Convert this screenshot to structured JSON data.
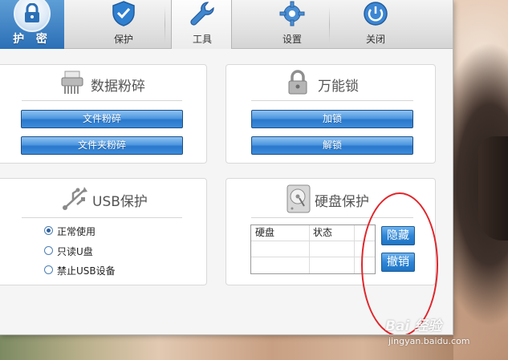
{
  "toolbar": {
    "logo_text": "护 密",
    "tabs": [
      {
        "label": "保护",
        "icon": "shield-icon"
      },
      {
        "label": "工具",
        "icon": "wrench-icon",
        "active": true
      },
      {
        "label": "设置",
        "icon": "gear-icon"
      },
      {
        "label": "关闭",
        "icon": "power-icon"
      }
    ]
  },
  "shredder": {
    "title": "数据粉碎",
    "icon": "shredder-icon",
    "file_button": "文件粉碎",
    "folder_button": "文件夹粉碎"
  },
  "master_lock": {
    "title": "万能锁",
    "icon": "padlock-icon",
    "lock_button": "加锁",
    "unlock_button": "解锁"
  },
  "usb": {
    "title": "USB保护",
    "icon": "usb-icon",
    "options": [
      {
        "label": "正常使用",
        "checked": true
      },
      {
        "label": "只读U盘",
        "checked": false
      },
      {
        "label": "禁止USB设备",
        "checked": false
      }
    ]
  },
  "disk": {
    "title": "硬盘保护",
    "icon": "hard-disk-icon",
    "columns": [
      "硬盘",
      "状态"
    ],
    "hide_button": "隐藏",
    "revoke_button": "撤销"
  },
  "watermark": {
    "logo": "Bai 经验",
    "url": "jingyan.baidu.com"
  },
  "colors": {
    "accent_blue": "#2a78cc",
    "annotation_red": "#e0262b"
  }
}
